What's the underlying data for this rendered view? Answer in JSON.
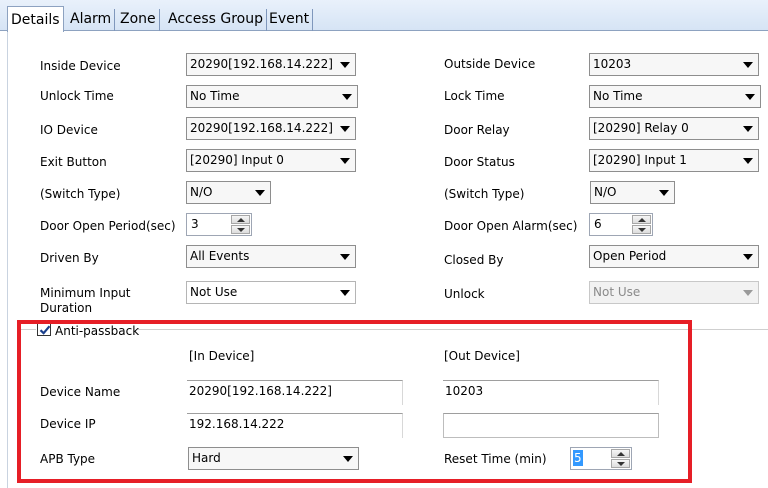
{
  "tabs": [
    "Details",
    "Alarm",
    "Zone",
    "Access Group",
    "Event"
  ],
  "active_tab": "Details",
  "colors": {
    "highlight_border": "#e61e26",
    "selection": "#3399ff"
  },
  "left": {
    "inside_device_label": "Inside Device",
    "inside_device_value": "20290[192.168.14.222]",
    "unlock_time_label": "Unlock Time",
    "unlock_time_value": "No Time",
    "io_device_label": "IO Device",
    "io_device_value": "20290[192.168.14.222]",
    "exit_button_label": "Exit Button",
    "exit_button_value": "[20290] Input 0",
    "switch_type_label": "(Switch Type)",
    "switch_type_value": "N/O",
    "door_open_period_label": "Door Open Period(sec)",
    "door_open_period_value": "3",
    "driven_by_label": "Driven By",
    "driven_by_value": "All Events",
    "min_input_duration_label": "Minimum Input Duration",
    "min_input_duration_value": "Not Use"
  },
  "right": {
    "outside_device_label": "Outside Device",
    "outside_device_value": "10203",
    "lock_time_label": "Lock Time",
    "lock_time_value": "No Time",
    "door_relay_label": "Door Relay",
    "door_relay_value": "[20290] Relay 0",
    "door_status_label": "Door Status",
    "door_status_value": "[20290] Input 1",
    "switch_type_label": "(Switch Type)",
    "switch_type_value": "N/O",
    "door_open_alarm_label": "Door Open Alarm(sec)",
    "door_open_alarm_value": "6",
    "closed_by_label": "Closed By",
    "closed_by_value": "Open Period",
    "unlock_label": "Unlock",
    "unlock_value": "Not Use"
  },
  "apb": {
    "checkbox_label": "Anti-passback",
    "checked": true,
    "in_device_header": "[In Device]",
    "out_device_header": "[Out Device]",
    "device_name_label": "Device Name",
    "in_device_name": "20290[192.168.14.222]",
    "out_device_name": "10203",
    "device_ip_label": "Device IP",
    "in_device_ip": "192.168.14.222",
    "out_device_ip": "",
    "apb_type_label": "APB Type",
    "apb_type_value": "Hard",
    "reset_time_label": "Reset Time (min)",
    "reset_time_value": "5"
  }
}
